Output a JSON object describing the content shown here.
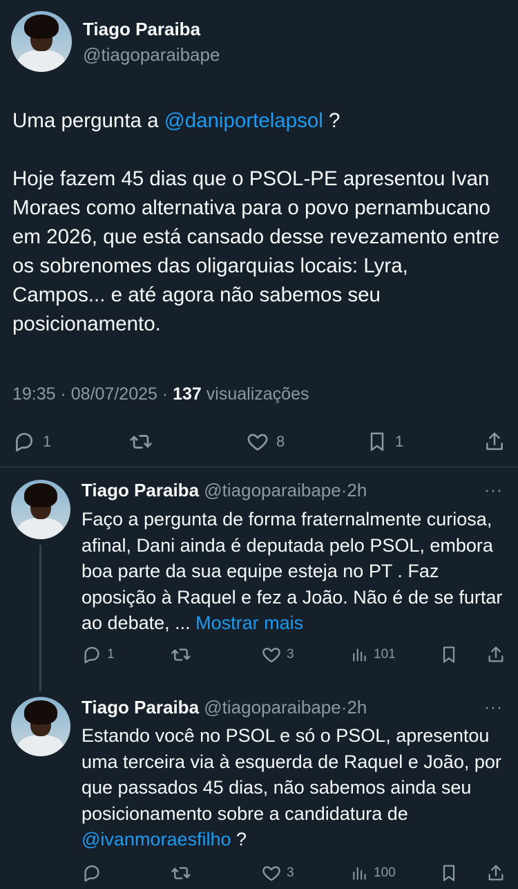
{
  "main_tweet": {
    "author_name": "Tiago Paraiba",
    "author_handle": "@tiagoparaibape",
    "text_line1_before": "Uma pergunta a ",
    "text_line1_mention": "@daniportelapsol",
    "text_line1_after": " ?",
    "paragraph2": "Hoje fazem 45 dias que o PSOL-PE apresentou Ivan Moraes como alternativa para o povo pernambucano em 2026, que está  cansado desse revezamento entre os sobrenomes das oligarquias locais: Lyra, Campos... e até agora não sabemos seu posicionamento.",
    "time": "19:35",
    "date": "08/07/2025",
    "separator": " · ",
    "views_count": "137",
    "views_label": "visualizações",
    "actions": {
      "reply_count": "1",
      "retweet_count": "",
      "like_count": "8",
      "bookmark_count": "1"
    }
  },
  "replies": [
    {
      "author_name": "Tiago Paraiba",
      "author_handle": "@tiagoparaibape",
      "age": "·2h",
      "more": "···",
      "text": "Faço a pergunta de forma fraternalmente curiosa, afinal, Dani ainda é deputada pelo PSOL, embora boa parte da sua equipe esteja no PT . Faz oposição à Raquel e fez a João. Não é de se furtar ao debate, ... ",
      "show_more": "Mostrar mais",
      "reply_count": "1",
      "retweet_count": "",
      "like_count": "3",
      "views_count": "101"
    },
    {
      "author_name": "Tiago Paraiba",
      "author_handle": "@tiagoparaibape",
      "age": "·2h",
      "more": "···",
      "text_before": "Estando você no PSOL e  só o PSOL, apresentou uma terceira via à esquerda de Raquel e João, por que passados 45 dias, não sabemos ainda seu posicionamento sobre a candidatura de ",
      "text_mention": "@ivanmoraesfilho",
      "text_after": " ?",
      "reply_count": "",
      "retweet_count": "",
      "like_count": "3",
      "views_count": "100"
    }
  ],
  "colors": {
    "background": "#15202b",
    "text": "#f7f9f9",
    "secondary": "#8b98a5",
    "accent": "#1d9bf0",
    "divider": "#38444d"
  },
  "icons": [
    "reply-icon",
    "retweet-icon",
    "like-icon",
    "bookmark-icon",
    "share-icon",
    "views-icon",
    "more-icon"
  ]
}
